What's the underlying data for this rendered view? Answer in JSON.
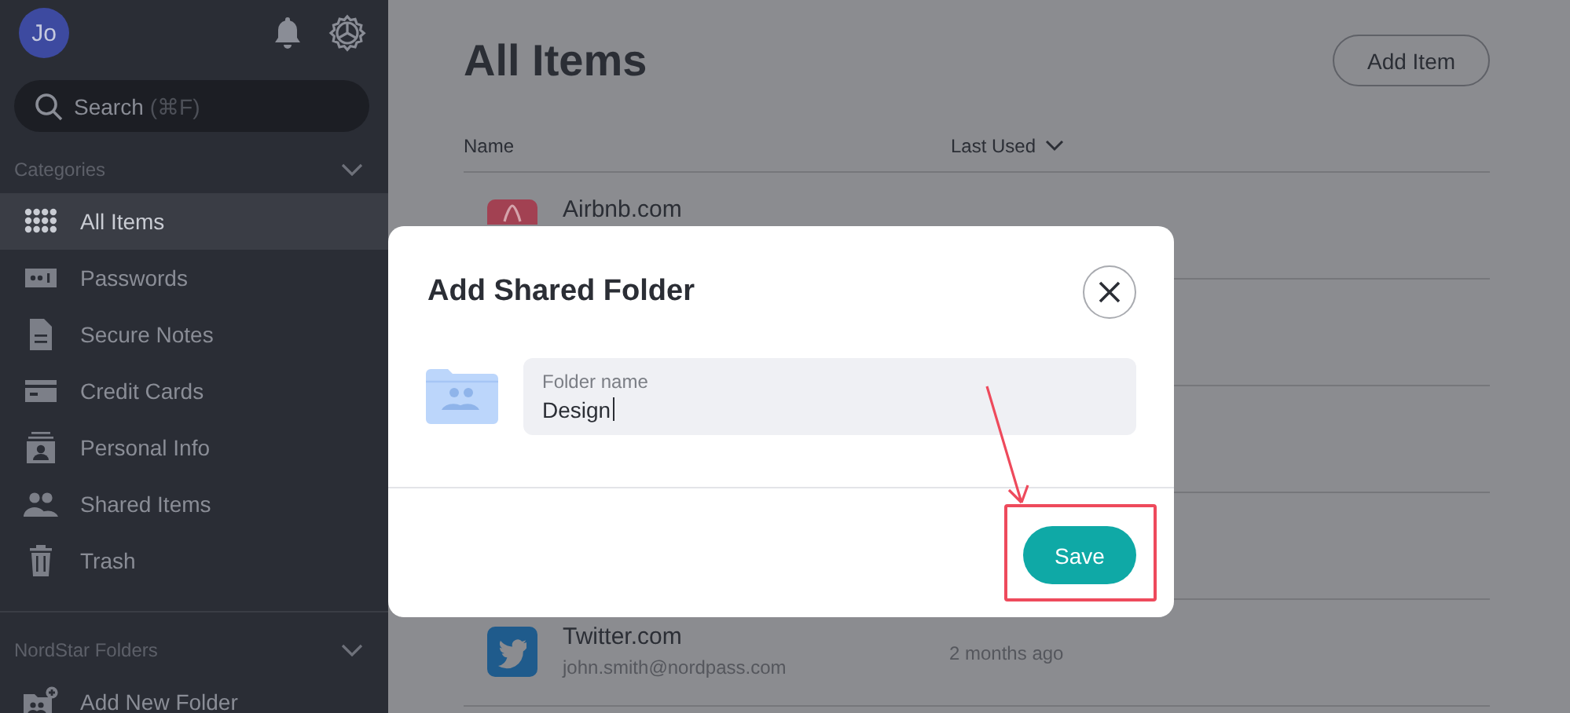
{
  "sidebar": {
    "avatar": "Jo",
    "search": {
      "placeholder": "Search",
      "shortcut": "(⌘F)"
    },
    "sections": [
      {
        "title": "Categories",
        "items": [
          {
            "label": "All Items",
            "selected": true
          },
          {
            "label": "Passwords",
            "selected": false
          },
          {
            "label": "Secure Notes",
            "selected": false
          },
          {
            "label": "Credit Cards",
            "selected": false
          },
          {
            "label": "Personal Info",
            "selected": false
          },
          {
            "label": "Shared Items",
            "selected": false
          },
          {
            "label": "Trash",
            "selected": false
          }
        ]
      },
      {
        "title": "NordStar Folders",
        "items": [
          {
            "label": "Add New Folder",
            "selected": false
          }
        ]
      }
    ]
  },
  "main": {
    "title": "All Items",
    "add_button": "Add Item",
    "columns": [
      "Name",
      "Last Used"
    ],
    "rows": [
      {
        "name": "Airbnb.com"
      },
      {
        "name": "Twitter.com",
        "account": "john.smith@nordpass.com",
        "last_used": "2 months ago"
      }
    ]
  },
  "dialog": {
    "title": "Add Shared Folder",
    "field": {
      "label": "Folder name",
      "value": "Design"
    },
    "save_button": "Save"
  }
}
